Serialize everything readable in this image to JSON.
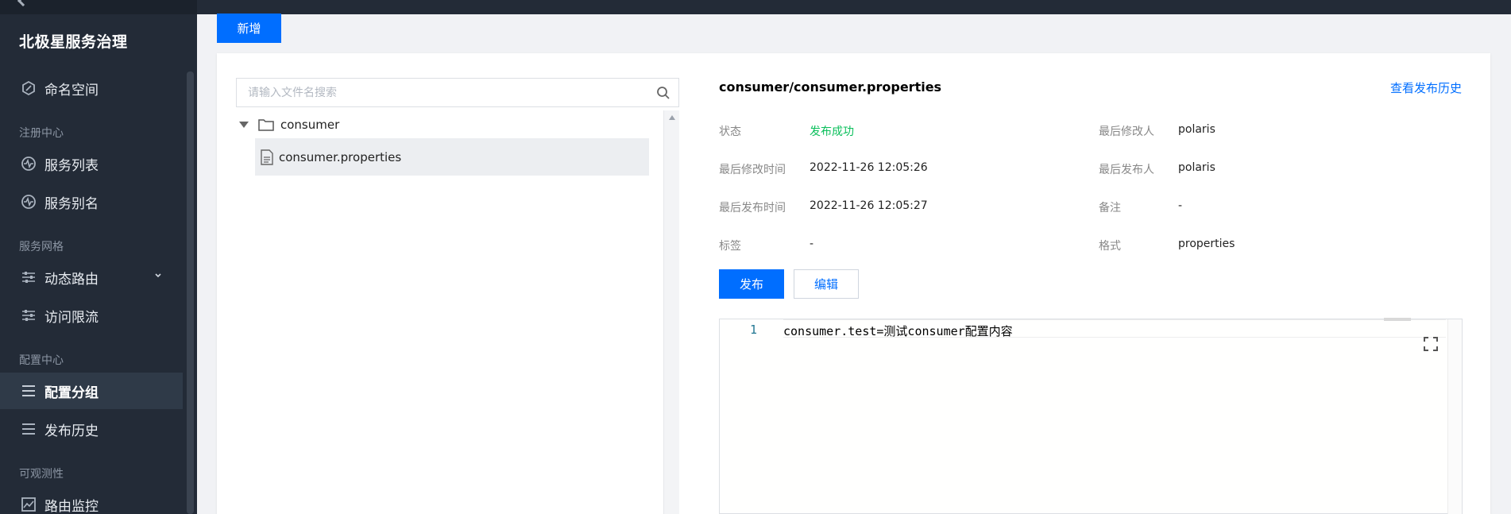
{
  "app": {
    "brand": "北极星服务治理"
  },
  "sidebar": {
    "items": [
      {
        "label": "命名空间",
        "icon": "namespace-icon"
      },
      {
        "label": "服务列表",
        "icon": "service-icon"
      },
      {
        "label": "服务别名",
        "icon": "service-icon"
      },
      {
        "label": "动态路由",
        "icon": "sliders-icon"
      },
      {
        "label": "访问限流",
        "icon": "sliders-icon"
      },
      {
        "label": "配置分组",
        "icon": "list-icon"
      },
      {
        "label": "发布历史",
        "icon": "list-icon"
      },
      {
        "label": "路由监控",
        "icon": "chart-icon"
      }
    ],
    "sections": {
      "registry": "注册中心",
      "mesh": "服务网格",
      "config": "配置中心",
      "observability": "可观测性"
    },
    "active_item": "配置分组"
  },
  "toolbar": {
    "add_label": "新增"
  },
  "tree": {
    "search_placeholder": "请输入文件名搜索",
    "folder": "consumer",
    "file": "consumer.properties"
  },
  "detail": {
    "title": "consumer/consumer.properties",
    "history_link": "查看发布历史",
    "fields": {
      "status_label": "状态",
      "status_value": "发布成功",
      "modified_time_label": "最后修改时间",
      "modified_time_value": "2022-11-26 12:05:26",
      "published_time_label": "最后发布时间",
      "published_time_value": "2022-11-26 12:05:27",
      "tags_label": "标签",
      "tags_value": "-",
      "modifier_label": "最后修改人",
      "modifier_value": "polaris",
      "publisher_label": "最后发布人",
      "publisher_value": "polaris",
      "comment_label": "备注",
      "comment_value": "-",
      "format_label": "格式",
      "format_value": "properties"
    },
    "publish_label": "发布",
    "edit_label": "编辑"
  },
  "editor": {
    "line_number": "1",
    "content": "consumer.test=测试consumer配置内容"
  },
  "colors": {
    "primary": "#006eff",
    "success": "#0abf5b",
    "sidebar_bg": "#232b37"
  }
}
